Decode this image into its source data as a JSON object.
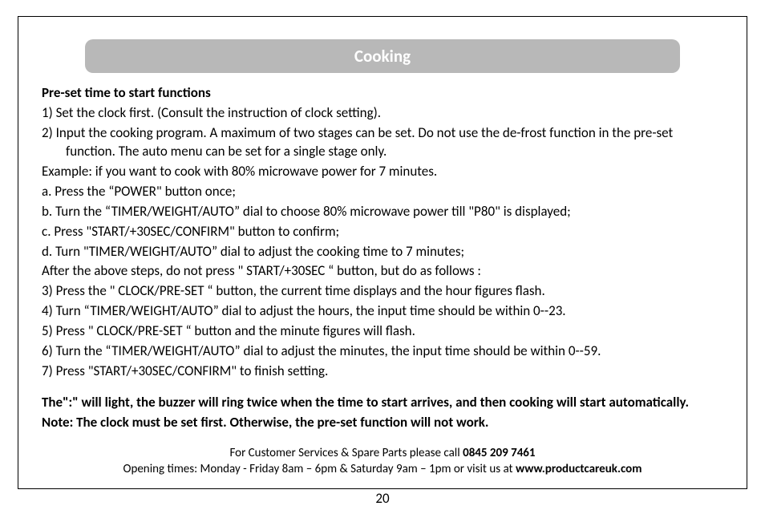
{
  "heading": "Cooking",
  "subheading": "Pre-set time to start functions",
  "lines": {
    "l1": "1)  Set the clock first. (Consult the instruction of clock setting).",
    "l2": "2)    Input the cooking program.  A maximum of two stages can be set. Do not use the de-frost function in the pre-set function. The auto menu can be set for a single stage only.",
    "l3": "Example: if you want to cook with 80% microwave power for 7 minutes.",
    "l4": "a. Press the “POWER\" button once;",
    "l5": "b. Turn the “TIMER/WEIGHT/AUTO” dial to choose 80% microwave power till \"P80\" is displayed;",
    "l6": "c. Press \"START/+30SEC/CONFIRM\" button to confirm;",
    "l7": "d. Turn \"TIMER/WEIGHT/AUTO” dial to adjust the cooking time to 7 minutes;",
    "l8": "After the above steps, do not press \" START/+30SEC “ button, but do as follows :",
    "l9": "3) Press the \" CLOCK/PRE-SET “ button, the current time displays and the hour figures flash.",
    "l10": "4) Turn “TIMER/WEIGHT/AUTO” dial to adjust the hours, the input time should be within  0--23.",
    "l11": "5) Press \" CLOCK/PRE-SET “ button and the minute figures will flash.",
    "l12": "6) Turn the “TIMER/WEIGHT/AUTO” dial to adjust the minutes, the input time should be within 0--59.",
    "l13": "7) Press \"START/+30SEC/CONFIRM\" to finish setting."
  },
  "bold_note": {
    "p1": "The\":\" will light, the buzzer will ring twice when the time to start arrives, and then cooking will start automatically.",
    "p2": "Note: The clock must be set first. Otherwise, the pre-set function will not work."
  },
  "footer": {
    "line1_pre": "For Customer Services & Spare Parts please call ",
    "phone": "0845 209 7461",
    "line2_pre": "Opening times: Monday - Friday  8am – 6pm & Saturday 9am – 1pm or visit us at ",
    "site": "www.productcareuk.com"
  },
  "page_number": "20"
}
